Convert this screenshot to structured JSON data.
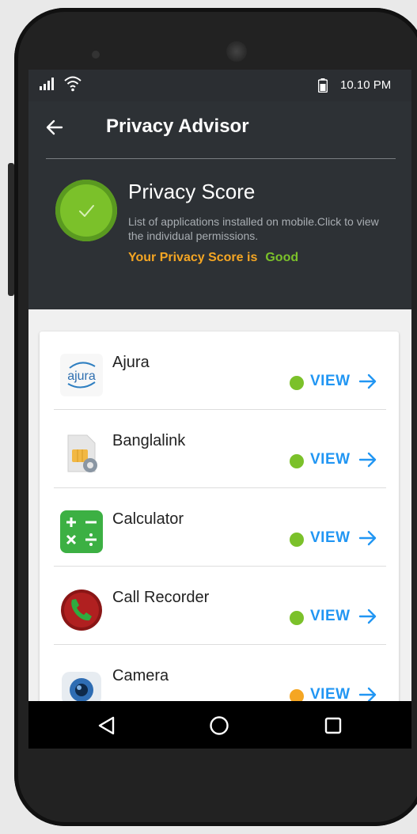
{
  "status_bar": {
    "time": "10.10 PM"
  },
  "appbar": {
    "title": "Privacy Advisor"
  },
  "score": {
    "title": "Privacy Score",
    "description": "List of applications installed on mobile.Click to view the individual permissions.",
    "label": "Your Privacy Score is",
    "value": "Good"
  },
  "colors": {
    "green": "#7bc12a",
    "orange": "#f5a623",
    "blue": "#2196f3"
  },
  "apps": [
    {
      "name": "Ajura",
      "status": "green",
      "action": "VIEW",
      "icon": "ajura-logo-icon"
    },
    {
      "name": "Banglalink",
      "status": "green",
      "action": "VIEW",
      "icon": "sim-card-settings-icon"
    },
    {
      "name": "Calculator",
      "status": "green",
      "action": "VIEW",
      "icon": "calculator-icon"
    },
    {
      "name": "Call Recorder",
      "status": "green",
      "action": "VIEW",
      "icon": "call-recorder-icon"
    },
    {
      "name": "Camera",
      "status": "orange",
      "action": "VIEW",
      "icon": "camera-icon"
    }
  ]
}
